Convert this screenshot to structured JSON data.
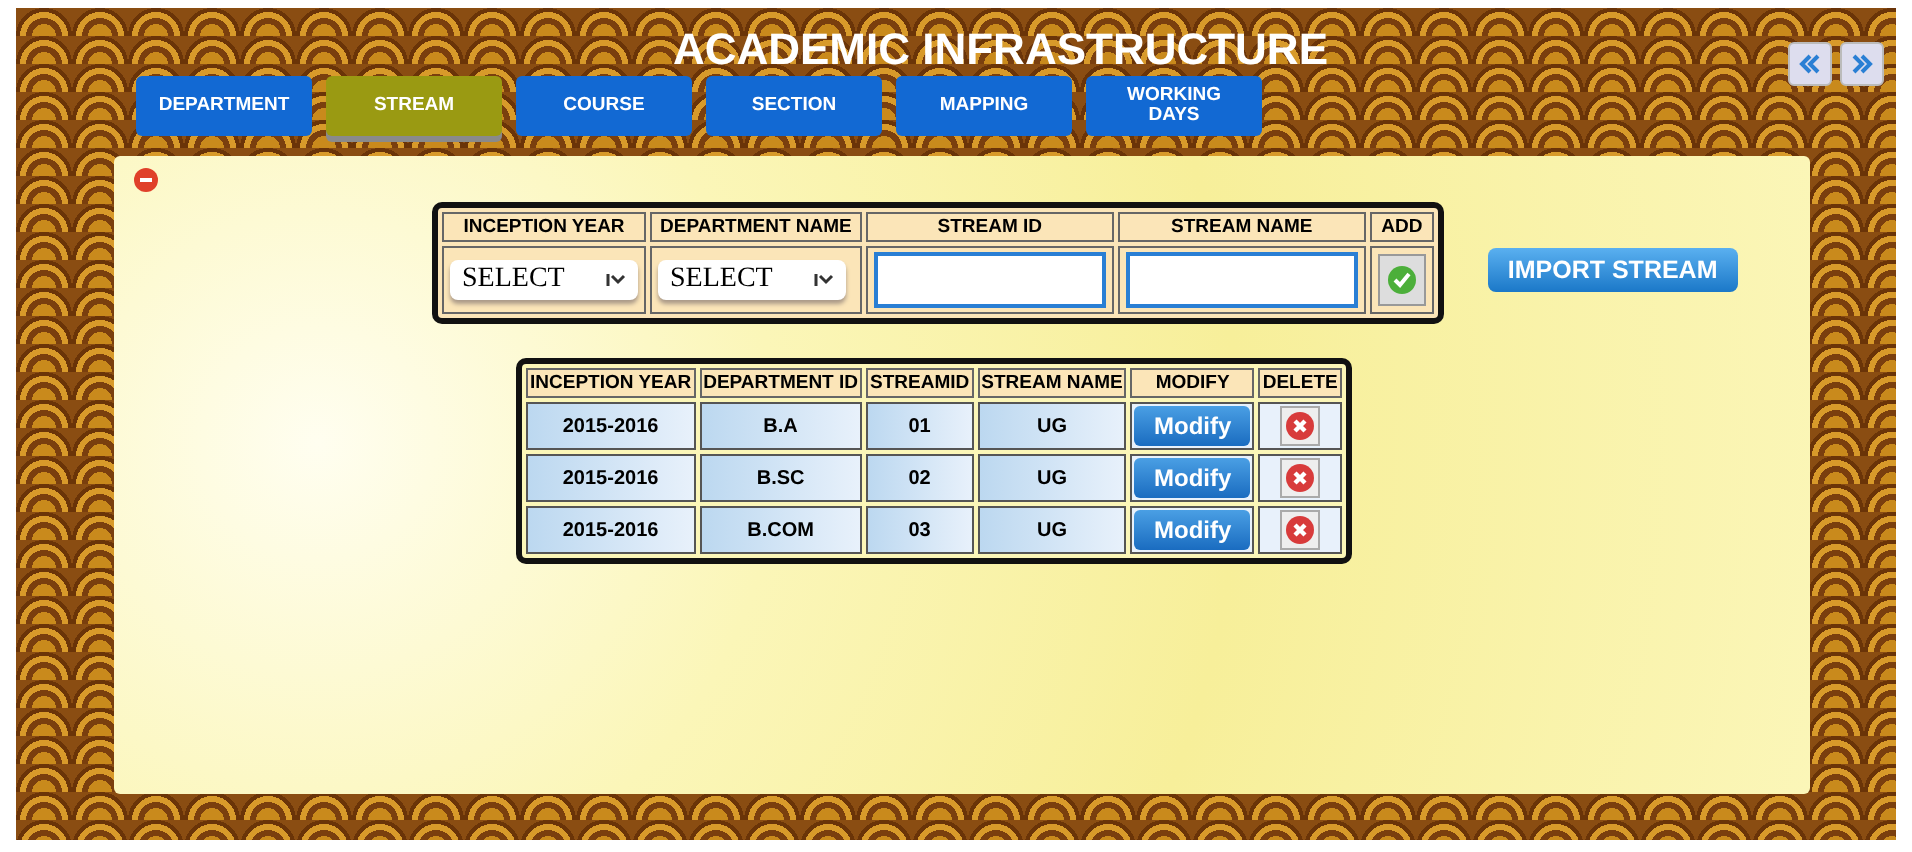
{
  "title": "ACADEMIC INFRASTRUCTURE",
  "tabs": [
    {
      "label": "DEPARTMENT",
      "selected": false
    },
    {
      "label": "STREAM",
      "selected": true
    },
    {
      "label": "COURSE",
      "selected": false
    },
    {
      "label": "SECTION",
      "selected": false
    },
    {
      "label": "MAPPING",
      "selected": false
    },
    {
      "label": "WORKING DAYS",
      "selected": false
    }
  ],
  "form": {
    "columns": [
      "INCEPTION YEAR",
      "DEPARTMENT NAME",
      "STREAM ID",
      "STREAM NAME",
      "ADD"
    ],
    "inception_year": "SELECT",
    "department_name": "SELECT"
  },
  "import_button": "IMPORT STREAM",
  "table": {
    "columns": [
      "INCEPTION YEAR",
      "DEPARTMENT ID",
      "STREAMID",
      "STREAM NAME",
      "MODIFY",
      "DELETE"
    ],
    "rows": [
      {
        "year": "2015-2016",
        "department": "B.A",
        "id": "01",
        "name": "UG",
        "modify": "Modify"
      },
      {
        "year": "2015-2016",
        "department": "B.SC",
        "id": "02",
        "name": "UG",
        "modify": "Modify"
      },
      {
        "year": "2015-2016",
        "department": "B.COM",
        "id": "03",
        "name": "UG",
        "modify": "Modify"
      }
    ]
  }
}
